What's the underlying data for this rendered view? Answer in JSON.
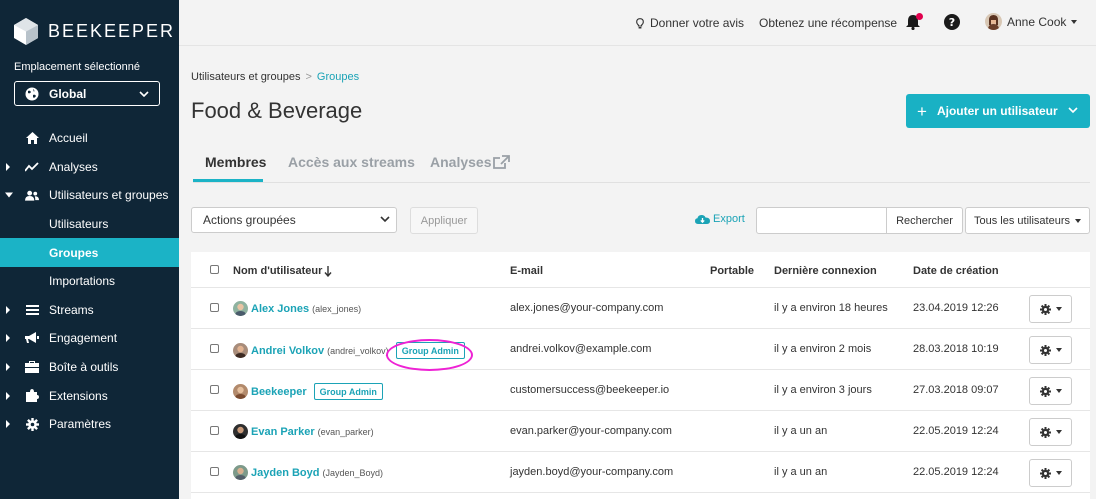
{
  "sidebar": {
    "brand": "BEEKEEPER",
    "location_label": "Emplacement sélectionné",
    "location_value": "Global",
    "items": [
      {
        "label": "Accueil"
      },
      {
        "label": "Analyses"
      },
      {
        "label": "Utilisateurs et groupes"
      },
      {
        "label": "Utilisateurs"
      },
      {
        "label": "Groupes"
      },
      {
        "label": "Importations"
      },
      {
        "label": "Streams"
      },
      {
        "label": "Engagement"
      },
      {
        "label": "Boîte à outils"
      },
      {
        "label": "Extensions"
      },
      {
        "label": "Paramètres"
      }
    ]
  },
  "topbar": {
    "feedback": "Donner votre avis",
    "reward": "Obtenez une récompense",
    "user_name": "Anne Cook"
  },
  "breadcrumb": {
    "parent": "Utilisateurs et groupes",
    "separator": ">",
    "current": "Groupes"
  },
  "page": {
    "title": "Food & Beverage",
    "add_button": "Ajouter un utilisateur"
  },
  "tabs": [
    {
      "label": "Membres"
    },
    {
      "label": "Accès aux streams"
    },
    {
      "label": "Analyses"
    }
  ],
  "toolbar": {
    "bulk_actions": "Actions groupées",
    "apply": "Appliquer",
    "export": "Export",
    "search_value": "",
    "search_button": "Rechercher",
    "filter": "Tous les utilisateurs"
  },
  "table": {
    "headers": {
      "username": "Nom d'utilisateur",
      "email": "E-mail",
      "portable": "Portable",
      "last_login": "Dernière connexion",
      "created": "Date de création"
    },
    "rows": [
      {
        "name": "Alex Jones",
        "handle": "(alex_jones)",
        "badge": "",
        "email": "alex.jones@your-company.com",
        "last_login": "il y a environ 18 heures",
        "created": "23.04.2019 12:26"
      },
      {
        "name": "Andrei Volkov",
        "handle": "(andrei_volkov)",
        "badge": "Group Admin",
        "email": "andrei.volkov@example.com",
        "last_login": "il y a environ 2 mois",
        "created": "28.03.2018 10:19"
      },
      {
        "name": "Beekeeper",
        "handle": "",
        "badge": "Group Admin",
        "email": "customersuccess@beekeeper.io",
        "last_login": "il y a environ 3 jours",
        "created": "27.03.2018 09:07"
      },
      {
        "name": "Evan Parker",
        "handle": "(evan_parker)",
        "badge": "",
        "email": "evan.parker@your-company.com",
        "last_login": "il y a un an",
        "created": "22.05.2019 12:24"
      },
      {
        "name": "Jayden Boyd",
        "handle": "(Jayden_Boyd)",
        "badge": "",
        "email": "jayden.boyd@your-company.com",
        "last_login": "il y a un an",
        "created": "22.05.2019 12:24"
      }
    ]
  },
  "colors": {
    "sidebar_bg": "#0f2637",
    "accent": "#1bb3c6",
    "notification": "#e0004d",
    "highlight_ring": "#ee22d4"
  }
}
